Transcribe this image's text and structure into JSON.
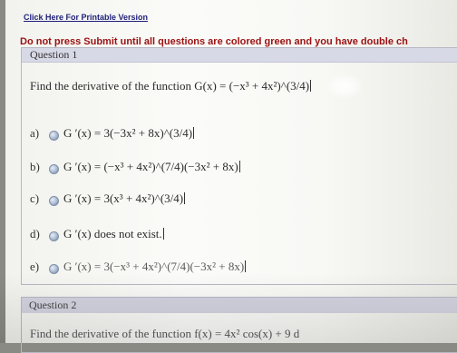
{
  "header": {
    "printable_link": "Click Here For Printable Version",
    "notice": "Do not press Submit until all questions are colored green and you have double ch"
  },
  "question1": {
    "title": "Question 1",
    "stem": "Find the derivative of the function G(x) = (−x³ + 4x²)^(3/4)",
    "options": [
      {
        "label": "a)",
        "text": "G ′(x) = 3(−3x² + 8x)^(3/4)"
      },
      {
        "label": "b)",
        "text": "G ′(x) = (−x³ + 4x²)^(7/4)(−3x² + 8x)"
      },
      {
        "label": "c)",
        "text": "G ′(x) = 3(x³ + 4x²)^(3/4)"
      },
      {
        "label": "d)",
        "text": "G ′(x) does not exist."
      },
      {
        "label": "e)",
        "text": "G ′(x) = 3(−x³ + 4x²)^(7/4)(−3x² + 8x)"
      }
    ]
  },
  "question2": {
    "title": "Question 2",
    "stem": "Find the derivative of the function f(x) = 4x² cos(x) + 9 d"
  }
}
